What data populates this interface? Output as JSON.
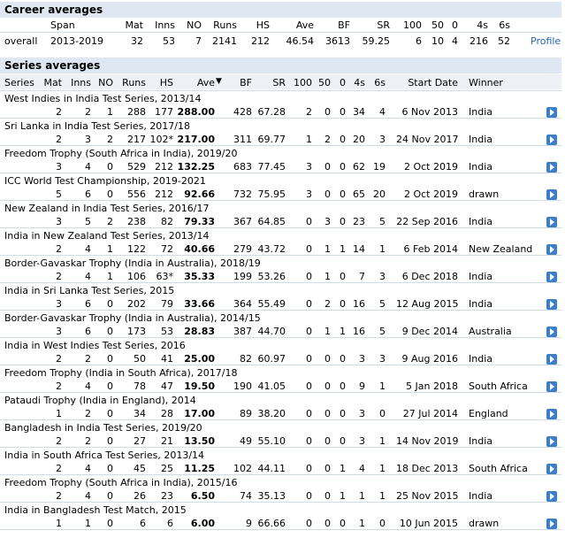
{
  "career": {
    "title": "Career averages",
    "headers": [
      "Span",
      "Mat",
      "Inns",
      "NO",
      "Runs",
      "HS",
      "Ave",
      "BF",
      "SR",
      "100",
      "50",
      "0",
      "4s",
      "6s"
    ],
    "row": {
      "label": "overall",
      "span": "2013-2019",
      "mat": "32",
      "inns": "53",
      "no": "7",
      "runs": "2141",
      "hs": "212",
      "ave": "46.54",
      "bf": "3613",
      "sr": "59.25",
      "hundreds": "6",
      "fifties": "10",
      "ducks": "4",
      "fours": "216",
      "sixes": "52"
    },
    "profile_label": "Profile"
  },
  "series": {
    "title": "Series averages",
    "headers": [
      "Series",
      "Mat",
      "Inns",
      "NO",
      "Runs",
      "HS",
      "Ave",
      "BF",
      "SR",
      "100",
      "50",
      "0",
      "4s",
      "6s",
      "Start Date",
      "Winner"
    ],
    "sort_indicator": "▼",
    "rows": [
      {
        "name": "West Indies in India Test Series, 2013/14",
        "mat": "2",
        "inns": "2",
        "no": "1",
        "runs": "288",
        "hs": "177",
        "ave": "288.00",
        "bf": "428",
        "sr": "67.28",
        "h": "2",
        "f": "0",
        "d": "0",
        "fours": "34",
        "sixes": "4",
        "date": "6 Nov 2013",
        "winner": "India"
      },
      {
        "name": "Sri Lanka in India Test Series, 2017/18",
        "mat": "2",
        "inns": "3",
        "no": "2",
        "runs": "217",
        "hs": "102*",
        "ave": "217.00",
        "bf": "311",
        "sr": "69.77",
        "h": "1",
        "f": "2",
        "d": "0",
        "fours": "20",
        "sixes": "3",
        "date": "24 Nov 2017",
        "winner": "India"
      },
      {
        "name": "Freedom Trophy (South Africa in India), 2019/20",
        "mat": "3",
        "inns": "4",
        "no": "0",
        "runs": "529",
        "hs": "212",
        "ave": "132.25",
        "bf": "683",
        "sr": "77.45",
        "h": "3",
        "f": "0",
        "d": "0",
        "fours": "62",
        "sixes": "19",
        "date": "2 Oct 2019",
        "winner": "India"
      },
      {
        "name": "ICC World Test Championship, 2019-2021",
        "mat": "5",
        "inns": "6",
        "no": "0",
        "runs": "556",
        "hs": "212",
        "ave": "92.66",
        "bf": "732",
        "sr": "75.95",
        "h": "3",
        "f": "0",
        "d": "0",
        "fours": "65",
        "sixes": "20",
        "date": "2 Oct 2019",
        "winner": "drawn"
      },
      {
        "name": "New Zealand in India Test Series, 2016/17",
        "mat": "3",
        "inns": "5",
        "no": "2",
        "runs": "238",
        "hs": "82",
        "ave": "79.33",
        "bf": "367",
        "sr": "64.85",
        "h": "0",
        "f": "3",
        "d": "0",
        "fours": "23",
        "sixes": "5",
        "date": "22 Sep 2016",
        "winner": "India"
      },
      {
        "name": "India in New Zealand Test Series, 2013/14",
        "mat": "2",
        "inns": "4",
        "no": "1",
        "runs": "122",
        "hs": "72",
        "ave": "40.66",
        "bf": "279",
        "sr": "43.72",
        "h": "0",
        "f": "1",
        "d": "1",
        "fours": "14",
        "sixes": "1",
        "date": "6 Feb 2014",
        "winner": "New Zealand"
      },
      {
        "name": "Border-Gavaskar Trophy (India in Australia), 2018/19",
        "mat": "2",
        "inns": "4",
        "no": "1",
        "runs": "106",
        "hs": "63*",
        "ave": "35.33",
        "bf": "199",
        "sr": "53.26",
        "h": "0",
        "f": "1",
        "d": "0",
        "fours": "7",
        "sixes": "3",
        "date": "6 Dec 2018",
        "winner": "India"
      },
      {
        "name": "India in Sri Lanka Test Series, 2015",
        "mat": "3",
        "inns": "6",
        "no": "0",
        "runs": "202",
        "hs": "79",
        "ave": "33.66",
        "bf": "364",
        "sr": "55.49",
        "h": "0",
        "f": "2",
        "d": "0",
        "fours": "16",
        "sixes": "5",
        "date": "12 Aug 2015",
        "winner": "India"
      },
      {
        "name": "Border-Gavaskar Trophy (India in Australia), 2014/15",
        "mat": "3",
        "inns": "6",
        "no": "0",
        "runs": "173",
        "hs": "53",
        "ave": "28.83",
        "bf": "387",
        "sr": "44.70",
        "h": "0",
        "f": "1",
        "d": "1",
        "fours": "16",
        "sixes": "5",
        "date": "9 Dec 2014",
        "winner": "Australia"
      },
      {
        "name": "India in West Indies Test Series, 2016",
        "mat": "2",
        "inns": "2",
        "no": "0",
        "runs": "50",
        "hs": "41",
        "ave": "25.00",
        "bf": "82",
        "sr": "60.97",
        "h": "0",
        "f": "0",
        "d": "0",
        "fours": "3",
        "sixes": "3",
        "date": "9 Aug 2016",
        "winner": "India"
      },
      {
        "name": "Freedom Trophy (India in South Africa), 2017/18",
        "mat": "2",
        "inns": "4",
        "no": "0",
        "runs": "78",
        "hs": "47",
        "ave": "19.50",
        "bf": "190",
        "sr": "41.05",
        "h": "0",
        "f": "0",
        "d": "0",
        "fours": "9",
        "sixes": "1",
        "date": "5 Jan 2018",
        "winner": "South Africa"
      },
      {
        "name": "Pataudi Trophy (India in England), 2014",
        "mat": "1",
        "inns": "2",
        "no": "0",
        "runs": "34",
        "hs": "28",
        "ave": "17.00",
        "bf": "89",
        "sr": "38.20",
        "h": "0",
        "f": "0",
        "d": "0",
        "fours": "3",
        "sixes": "0",
        "date": "27 Jul 2014",
        "winner": "England"
      },
      {
        "name": "Bangladesh in India Test Series, 2019/20",
        "mat": "2",
        "inns": "2",
        "no": "0",
        "runs": "27",
        "hs": "21",
        "ave": "13.50",
        "bf": "49",
        "sr": "55.10",
        "h": "0",
        "f": "0",
        "d": "0",
        "fours": "3",
        "sixes": "1",
        "date": "14 Nov 2019",
        "winner": "India"
      },
      {
        "name": "India in South Africa Test Series, 2013/14",
        "mat": "2",
        "inns": "4",
        "no": "0",
        "runs": "45",
        "hs": "25",
        "ave": "11.25",
        "bf": "102",
        "sr": "44.11",
        "h": "0",
        "f": "0",
        "d": "1",
        "fours": "4",
        "sixes": "1",
        "date": "18 Dec 2013",
        "winner": "South Africa"
      },
      {
        "name": "Freedom Trophy (South Africa in India), 2015/16",
        "mat": "2",
        "inns": "4",
        "no": "0",
        "runs": "26",
        "hs": "23",
        "ave": "6.50",
        "bf": "74",
        "sr": "35.13",
        "h": "0",
        "f": "0",
        "d": "1",
        "fours": "1",
        "sixes": "1",
        "date": "25 Nov 2015",
        "winner": "India"
      },
      {
        "name": "India in Bangladesh Test Match, 2015",
        "mat": "1",
        "inns": "1",
        "no": "0",
        "runs": "6",
        "hs": "6",
        "ave": "6.00",
        "bf": "9",
        "sr": "66.66",
        "h": "0",
        "f": "0",
        "d": "0",
        "fours": "1",
        "sixes": "0",
        "date": "10 Jun 2015",
        "winner": "drawn"
      }
    ]
  },
  "icons": {
    "row_arrow": "play-arrow-icon",
    "sort": "sort-down-icon"
  },
  "colors": {
    "header_bg": "#dfe8f2",
    "link": "#2a63ac",
    "arrow": "#3d7fc4"
  }
}
